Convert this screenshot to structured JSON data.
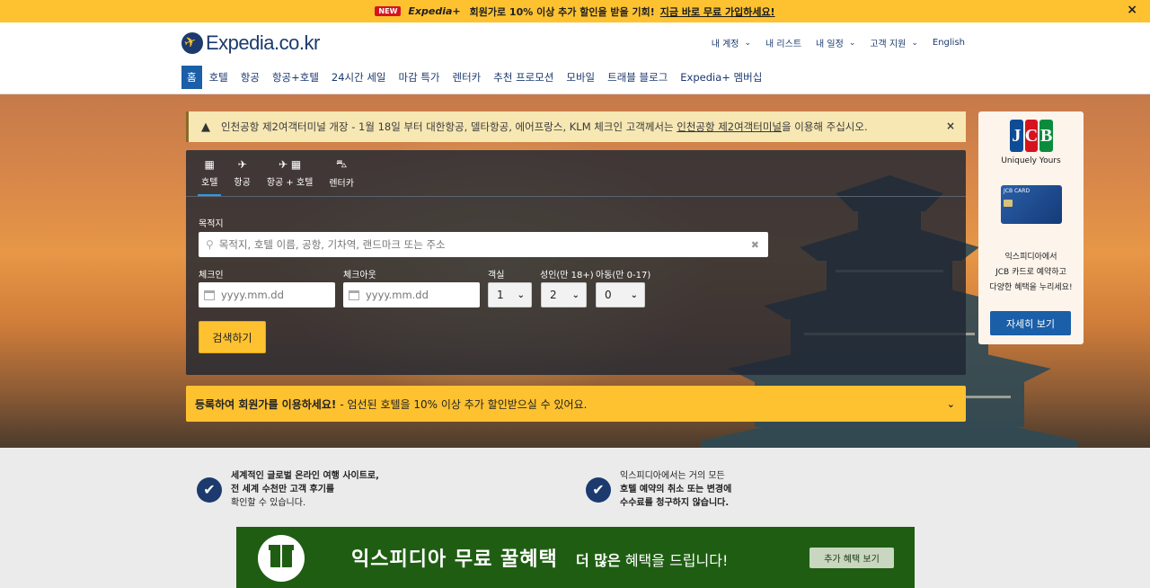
{
  "promo": {
    "badge": "NEW",
    "brand": "Expedia+",
    "text": "회원가로 10% 이상 추가 할인을 받을 기회!",
    "link": "지금 바로 무료 가입하세요!",
    "close": "×"
  },
  "header": {
    "logo": "Expedia.co.kr",
    "top_links": [
      "내 계정",
      "내 리스트",
      "내 일정",
      "고객 지원",
      "English"
    ],
    "nav": [
      "홈",
      "호텔",
      "항공",
      "항공+호텔",
      "24시간 세일",
      "마감 특가",
      "렌터카",
      "추천 프로모션",
      "모바일",
      "트래블 블로그",
      "Expedia+ 멤버십"
    ]
  },
  "alert": {
    "text_before": "인천공항 제2여객터미널 개장 - 1월 18일 부터 대한항공, 델타항공, 에어프랑스, KLM 체크인 고객께서는 ",
    "link": "인천공항 제2여객터미널",
    "text_after": "을 이용해 주십시오.",
    "close": "×"
  },
  "search": {
    "tabs": [
      "호텔",
      "항공",
      "항공 + 호텔",
      "렌터카"
    ],
    "destination_label": "목적지",
    "destination_placeholder": "목적지, 호텔 이름, 공항, 기차역, 랜드마크 또는 주소",
    "checkin_label": "체크인",
    "checkout_label": "체크아웃",
    "date_placeholder": "yyyy.mm.dd",
    "rooms_label": "객실",
    "adults_label": "성인(만 18+)",
    "children_label": "아동(만 0-17)",
    "rooms_value": "1",
    "adults_value": "2",
    "children_value": "0",
    "button": "검색하기"
  },
  "member_bar": {
    "bold": "등록하여 회원가를 이용하세요!",
    "text": "- 엄선된 호텔을 10% 이상 추가 할인받으실 수 있어요."
  },
  "jcb": {
    "logo": [
      "J",
      "C",
      "B"
    ],
    "tagline": "Uniquely Yours",
    "card_label": "JCB CARD",
    "text_lines": [
      "익스피디아에서",
      "JCB 카드로 예약하고",
      "다양한 혜택을 누리세요!"
    ],
    "button": "자세히 보기"
  },
  "benefits": [
    {
      "bold1": "세계적인 글로벌 온라인 여행 사이트로,",
      "bold2": "전 세계 수천만 고객 후기를",
      "normal": "확인할 수 있습니다."
    },
    {
      "normal": "익스피디아에서는 거의 모든",
      "bold1": "호텔 예약의 취소 또는 변경에",
      "bold2": "수수료를 청구하지 않습니다."
    }
  ],
  "banner": {
    "title": "익스피디아 무료 꿀혜택",
    "sub_bold": "더 많은",
    "sub_text": "혜택을 드립니다!",
    "button": "추가 혜택 보기"
  },
  "colors": {
    "promo_yellow": "#fec231",
    "brand_navy": "#1c3a6e",
    "nav_active_blue": "#1a5fa8",
    "banner_green": "#1f5e12"
  }
}
